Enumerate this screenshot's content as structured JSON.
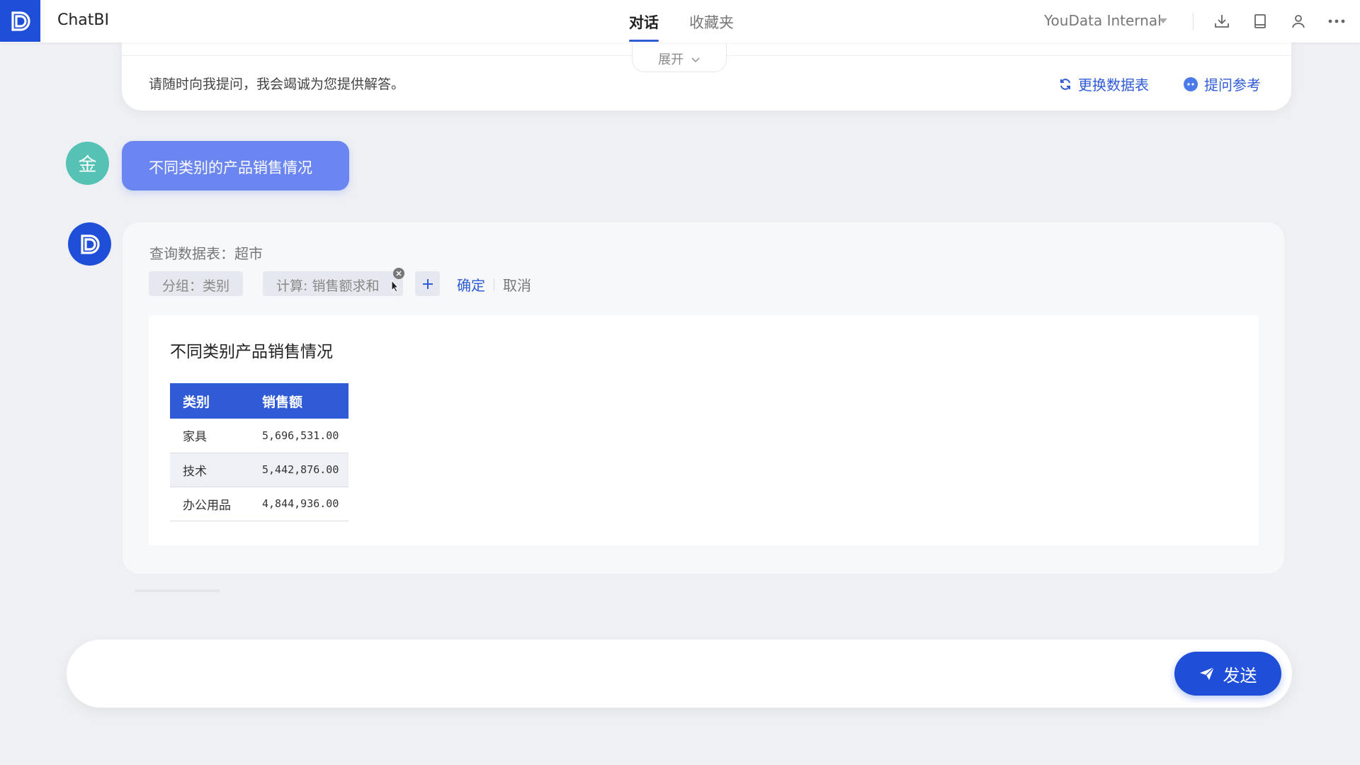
{
  "header": {
    "app_title": "ChatBI",
    "tabs": [
      {
        "label": "对话",
        "active": true
      },
      {
        "label": "收藏夹",
        "active": false
      }
    ],
    "workspace": "YouData Internal",
    "icons": [
      "download-icon",
      "book-icon",
      "user-icon",
      "more-icon"
    ]
  },
  "intro": {
    "expand_label": "展开",
    "message": "请随时向我提问，我会竭诚为您提供解答。",
    "switch_table_label": "更换数据表",
    "question_ref_label": "提问参考"
  },
  "user_message": {
    "avatar_text": "金",
    "text": "不同类别的产品销售情况"
  },
  "bot_message": {
    "query_table_label": "查询数据表：超市",
    "chips": [
      {
        "label": "分组：类别"
      },
      {
        "label": "计算: 销售额求和"
      }
    ],
    "confirm_label": "确定",
    "cancel_label": "取消",
    "result_title": "不同类别产品销售情况",
    "table": {
      "columns": [
        "类别",
        "销售额"
      ],
      "rows": [
        [
          "家具",
          "5,696,531.00"
        ],
        [
          "技术",
          "5,442,876.00"
        ],
        [
          "办公用品",
          "4,844,936.00"
        ]
      ]
    }
  },
  "input": {
    "placeholder": "",
    "send_label": "发送"
  },
  "colors": {
    "primary": "#1f4fd8",
    "user_bubble": "#6b86f0",
    "user_avatar": "#56c2b6"
  }
}
